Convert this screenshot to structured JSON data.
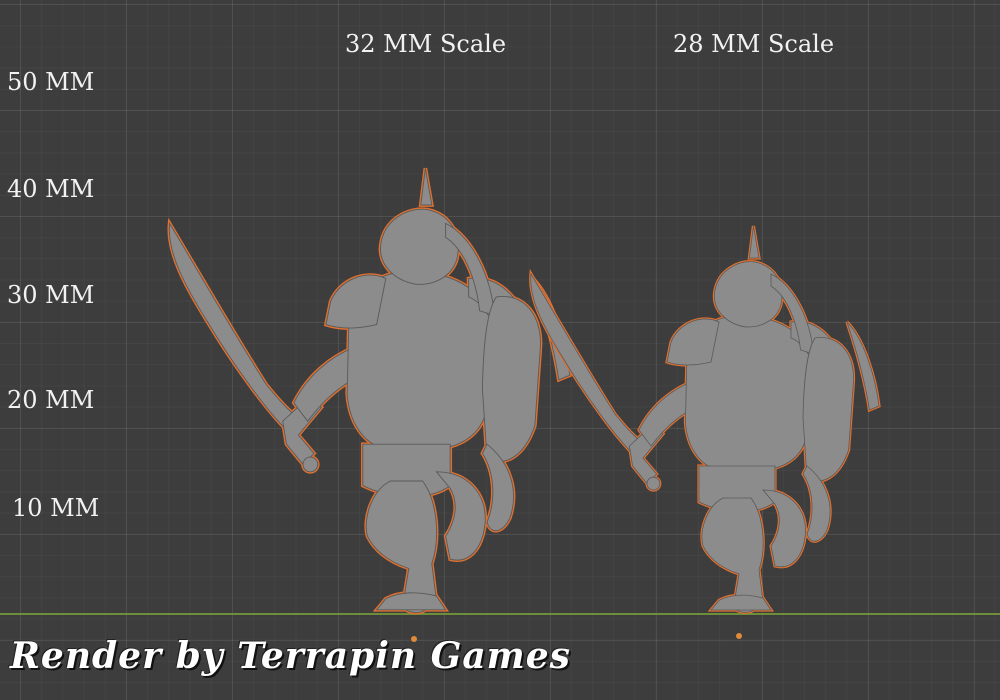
{
  "scale_labels": {
    "mm50": "50 MM",
    "mm40": "40 MM",
    "mm30": "30 MM",
    "mm20": "20 MM",
    "mm10": "10 MM"
  },
  "models": [
    {
      "label": "32 MM Scale"
    },
    {
      "label": "28 MM Scale"
    }
  ],
  "credit": "Render by Terrapin Games",
  "colors": {
    "background": "#3d3d3d",
    "ground_line": "#6d8f3a",
    "selection_outline": "#e07030",
    "model": "#8a8a8a"
  }
}
